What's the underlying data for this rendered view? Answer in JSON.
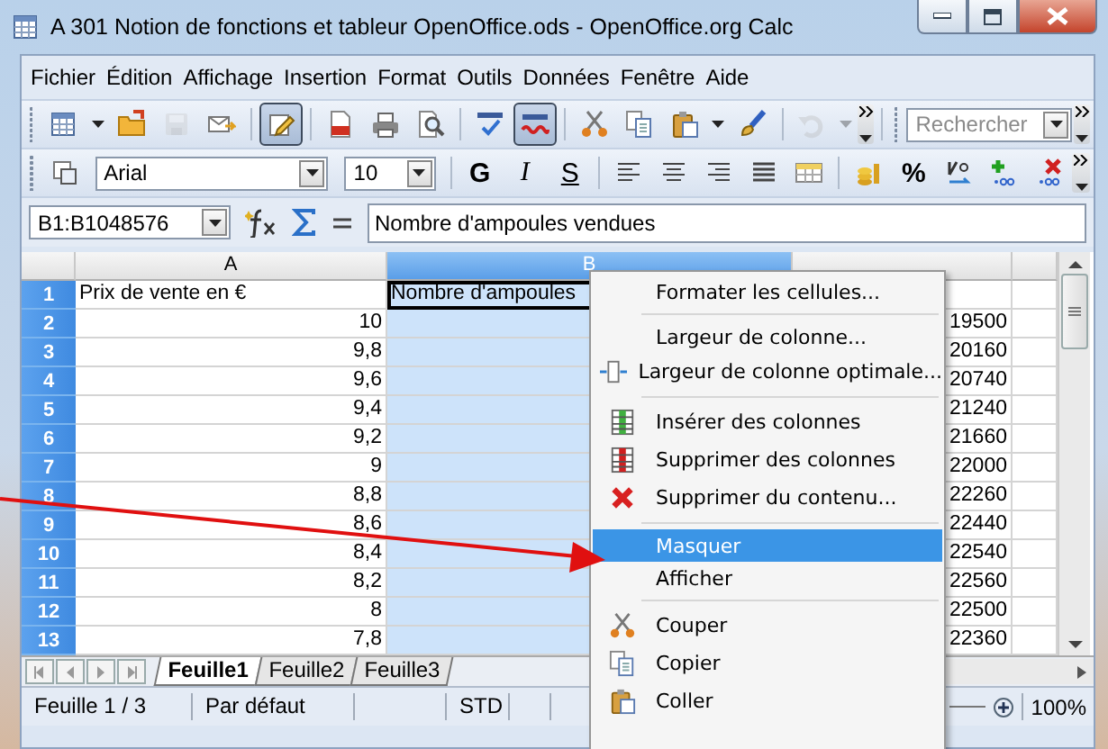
{
  "window": {
    "title": "A 301 Notion de fonctions et tableur OpenOffice.ods - OpenOffice.org Calc"
  },
  "menu_bar": [
    "Fichier",
    "Édition",
    "Affichage",
    "Insertion",
    "Format",
    "Outils",
    "Données",
    "Fenêtre",
    "Aide"
  ],
  "standard_toolbar": [
    {
      "kind": "new",
      "pressed": false,
      "disabled": false
    },
    {
      "kind": "dropdown",
      "disabled": false
    },
    {
      "kind": "open",
      "pressed": false,
      "disabled": false
    },
    {
      "kind": "save",
      "pressed": false,
      "disabled": true
    },
    {
      "kind": "email",
      "pressed": false,
      "disabled": false
    },
    {
      "kind": "separator"
    },
    {
      "kind": "edit",
      "pressed": true,
      "disabled": false
    },
    {
      "kind": "separator"
    },
    {
      "kind": "pdf",
      "pressed": false,
      "disabled": false
    },
    {
      "kind": "print",
      "pressed": false,
      "disabled": false
    },
    {
      "kind": "preview",
      "pressed": false,
      "disabled": false
    },
    {
      "kind": "separator"
    },
    {
      "kind": "spellcheck",
      "pressed": false,
      "disabled": false
    },
    {
      "kind": "autospell",
      "pressed": true,
      "disabled": false
    },
    {
      "kind": "separator"
    },
    {
      "kind": "cut",
      "pressed": false,
      "disabled": false
    },
    {
      "kind": "copy",
      "pressed": false,
      "disabled": false
    },
    {
      "kind": "paste",
      "pressed": false,
      "disabled": false
    },
    {
      "kind": "dropdown",
      "disabled": false
    },
    {
      "kind": "brush",
      "pressed": false,
      "disabled": false
    },
    {
      "kind": "separator"
    },
    {
      "kind": "undo",
      "pressed": false,
      "disabled": true
    },
    {
      "kind": "dropdown",
      "disabled": true
    }
  ],
  "search_field": {
    "placeholder": "Rechercher"
  },
  "formatting_toolbar": [
    {
      "kind": "styles"
    },
    {
      "kind": "font",
      "value": "Arial"
    },
    {
      "kind": "size",
      "value": "10"
    },
    {
      "kind": "separator"
    },
    {
      "kind": "bold",
      "label": "G"
    },
    {
      "kind": "italic",
      "label": "I"
    },
    {
      "kind": "underline",
      "label": "S"
    },
    {
      "kind": "separator"
    },
    {
      "kind": "align-left"
    },
    {
      "kind": "align-center"
    },
    {
      "kind": "align-right"
    },
    {
      "kind": "justify"
    },
    {
      "kind": "merge"
    },
    {
      "kind": "separator"
    },
    {
      "kind": "currency"
    },
    {
      "kind": "percent",
      "label": "%"
    },
    {
      "kind": "standard-format"
    },
    {
      "kind": "add-decimal"
    },
    {
      "kind": "delete-decimal"
    }
  ],
  "formula_bar": {
    "name_box": "B1:B1048576",
    "content": "Nombre d'ampoules vendues"
  },
  "sheet": {
    "columns": [
      {
        "label": "A",
        "selected": false
      },
      {
        "label": "B",
        "selected": true
      }
    ],
    "rows": [
      {
        "number": "1",
        "a": "Prix de vente en €",
        "b": "Nombre d'ampoules"
      },
      {
        "number": "2",
        "a": "10",
        "c": "19500"
      },
      {
        "number": "3",
        "a": "9,8",
        "c": "20160"
      },
      {
        "number": "4",
        "a": "9,6",
        "c": "20740"
      },
      {
        "number": "5",
        "a": "9,4",
        "c": "21240"
      },
      {
        "number": "6",
        "a": "9,2",
        "c": "21660"
      },
      {
        "number": "7",
        "a": "9",
        "c": "22000"
      },
      {
        "number": "8",
        "a": "8,8",
        "c": "22260"
      },
      {
        "number": "9",
        "a": "8,6",
        "c": "22440"
      },
      {
        "number": "10",
        "a": "8,4",
        "c": "22540"
      },
      {
        "number": "11",
        "a": "8,2",
        "c": "22560"
      },
      {
        "number": "12",
        "a": "8",
        "c": "22500"
      },
      {
        "number": "13",
        "a": "7,8",
        "c": "22360"
      }
    ]
  },
  "sheet_tabs": [
    {
      "label": "Feuille1",
      "selected": true
    },
    {
      "label": "Feuille2",
      "selected": false
    },
    {
      "label": "Feuille3",
      "selected": false
    }
  ],
  "status_bar": {
    "sheet": "Feuille 1 / 3",
    "page_style": "Par défaut",
    "selection_mode": "STD",
    "zoom": "100%"
  },
  "context_menu": [
    {
      "kind": "item",
      "label": "Formater les cellules...",
      "selected": false
    },
    {
      "kind": "separator"
    },
    {
      "kind": "item",
      "label": "Largeur de colonne...",
      "selected": false
    },
    {
      "kind": "item",
      "label": "Largeur de colonne optimale...",
      "selected": false
    },
    {
      "kind": "separator"
    },
    {
      "kind": "item",
      "label": "Insérer des colonnes",
      "selected": false
    },
    {
      "kind": "item",
      "label": "Supprimer des colonnes",
      "selected": false
    },
    {
      "kind": "item",
      "label": "Supprimer du contenu...",
      "selected": false
    },
    {
      "kind": "separator"
    },
    {
      "kind": "item",
      "label": "Masquer",
      "selected": true
    },
    {
      "kind": "item",
      "label": "Afficher",
      "selected": false
    },
    {
      "kind": "separator"
    },
    {
      "kind": "item",
      "label": "Couper",
      "selected": false
    },
    {
      "kind": "item",
      "label": "Copier",
      "selected": false
    },
    {
      "kind": "item",
      "label": "Coller",
      "selected": false
    }
  ]
}
